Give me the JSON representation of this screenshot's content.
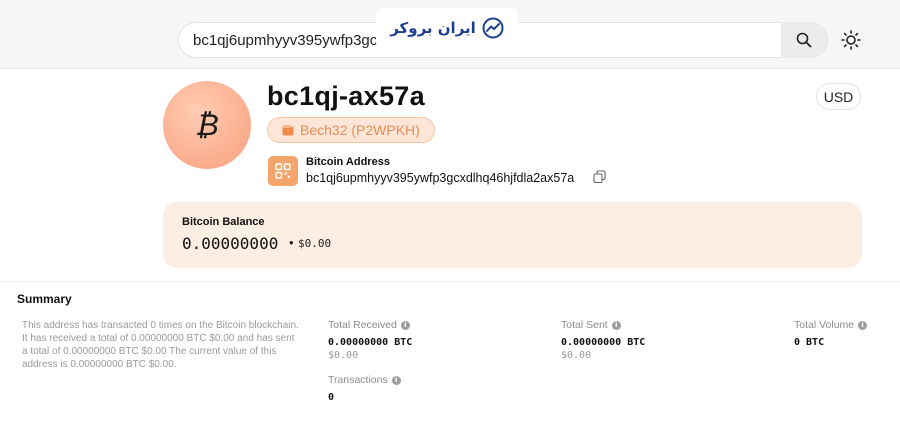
{
  "search": {
    "value": "bc1qj6upmhyyv395ywfp3gcxdlhq46hjfdla2ax57a",
    "display_value": "bc1qj6upmhyyv395ywfp3gcxd"
  },
  "watermark": {
    "text": "ایران بروکر"
  },
  "address": {
    "short": "bc1qj-ax57a",
    "type_badge": "Bech32 (P2WPKH)",
    "label": "Bitcoin Address",
    "full": "bc1qj6upmhyyv395ywfp3gcxdlhq46hjfdla2ax57a"
  },
  "currency": {
    "selected": "USD"
  },
  "balance": {
    "label": "Bitcoin Balance",
    "btc": "0.00000000",
    "separator": "•",
    "fiat": "$0.00"
  },
  "summary": {
    "title": "Summary",
    "description": "This address has transacted 0 times on the Bitcoin blockchain. It has received a total of 0.00000000 BTC $0.00 and has sent a total of 0.00000000 BTC $0.00 The current value of this address is 0.00000000 BTC $0.00.",
    "total_received": {
      "label": "Total Received",
      "value": "0.00000000 BTC",
      "fiat": "$0.00"
    },
    "total_sent": {
      "label": "Total Sent",
      "value": "0.00000000 BTC",
      "fiat": "$0.00"
    },
    "total_volume": {
      "label": "Total Volume",
      "value": "0 BTC"
    },
    "transactions": {
      "label": "Transactions",
      "value": "0"
    }
  },
  "icons": {
    "search": "search-icon",
    "theme": "sun-icon",
    "bitcoin": "bitcoin-icon",
    "wallet": "wallet-icon",
    "qr": "qr-code-icon",
    "copy": "copy-icon",
    "info": "info-icon"
  },
  "colors": {
    "accent": "#f3a56c",
    "badge_text": "#e58d55",
    "balance_card": "#fdeee3",
    "avatar": "#fcb294"
  }
}
